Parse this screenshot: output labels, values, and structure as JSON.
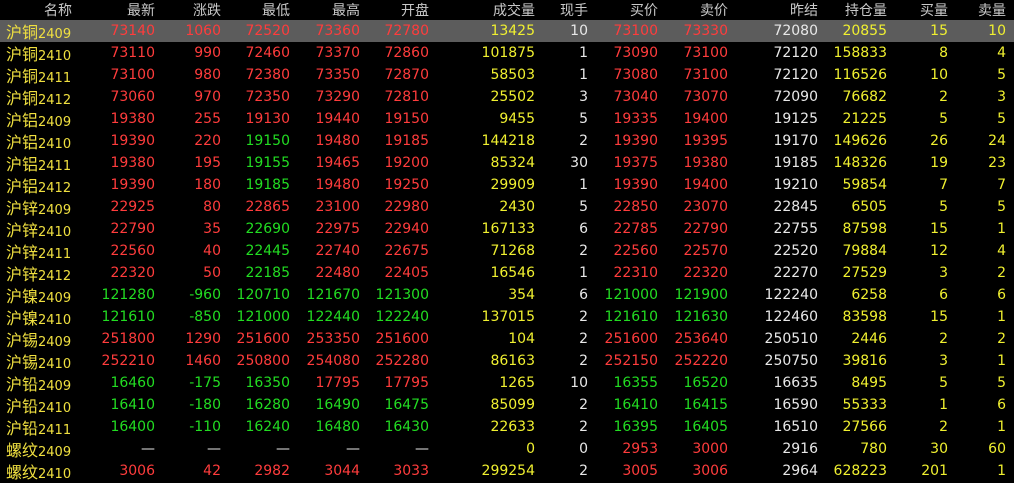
{
  "headers": [
    "名称",
    "最新",
    "涨跌",
    "最低",
    "最高",
    "开盘",
    "成交量",
    "现手",
    "买价",
    "卖价",
    "昨结",
    "持仓量",
    "买量",
    "卖量"
  ],
  "colors": {
    "up": "#ff3c3c",
    "down": "#22dd22",
    "flat": "#e8e8e8",
    "name": "#f0e040",
    "volume": "#f0f030",
    "selected_row": "#5c5c5c"
  },
  "rows": [
    {
      "zh": "沪铜",
      "code": "2409",
      "last": "73140",
      "change": "1060",
      "low": "72520",
      "high": "73360",
      "open": "72780",
      "volume": "13425",
      "cur_hand": "10",
      "bid": "73100",
      "ask": "73330",
      "prev_settle": "72080",
      "open_interest": "20855",
      "bid_vol": "15",
      "ask_vol": "10",
      "c": [
        "r",
        "r",
        "r",
        "r",
        "r",
        "r",
        "r"
      ]
    },
    {
      "zh": "沪铜",
      "code": "2410",
      "last": "73110",
      "change": "990",
      "low": "72460",
      "high": "73370",
      "open": "72860",
      "volume": "101875",
      "cur_hand": "1",
      "bid": "73090",
      "ask": "73100",
      "prev_settle": "72120",
      "open_interest": "158833",
      "bid_vol": "8",
      "ask_vol": "4",
      "c": [
        "r",
        "r",
        "r",
        "r",
        "r",
        "r",
        "r"
      ]
    },
    {
      "zh": "沪铜",
      "code": "2411",
      "last": "73100",
      "change": "980",
      "low": "72380",
      "high": "73350",
      "open": "72870",
      "volume": "58503",
      "cur_hand": "1",
      "bid": "73080",
      "ask": "73100",
      "prev_settle": "72120",
      "open_interest": "116526",
      "bid_vol": "10",
      "ask_vol": "5",
      "c": [
        "r",
        "r",
        "r",
        "r",
        "r",
        "r",
        "r"
      ]
    },
    {
      "zh": "沪铜",
      "code": "2412",
      "last": "73060",
      "change": "970",
      "low": "72350",
      "high": "73290",
      "open": "72810",
      "volume": "25502",
      "cur_hand": "3",
      "bid": "73040",
      "ask": "73070",
      "prev_settle": "72090",
      "open_interest": "76682",
      "bid_vol": "2",
      "ask_vol": "3",
      "c": [
        "r",
        "r",
        "r",
        "r",
        "r",
        "r",
        "r"
      ]
    },
    {
      "zh": "沪铝",
      "code": "2409",
      "last": "19380",
      "change": "255",
      "low": "19130",
      "high": "19440",
      "open": "19150",
      "volume": "9455",
      "cur_hand": "5",
      "bid": "19335",
      "ask": "19400",
      "prev_settle": "19125",
      "open_interest": "21225",
      "bid_vol": "5",
      "ask_vol": "5",
      "c": [
        "r",
        "r",
        "r",
        "r",
        "r",
        "r",
        "r"
      ]
    },
    {
      "zh": "沪铝",
      "code": "2410",
      "last": "19390",
      "change": "220",
      "low": "19150",
      "high": "19480",
      "open": "19185",
      "volume": "144218",
      "cur_hand": "2",
      "bid": "19390",
      "ask": "19395",
      "prev_settle": "19170",
      "open_interest": "149626",
      "bid_vol": "26",
      "ask_vol": "24",
      "c": [
        "r",
        "r",
        "g",
        "r",
        "r",
        "r",
        "r"
      ]
    },
    {
      "zh": "沪铝",
      "code": "2411",
      "last": "19380",
      "change": "195",
      "low": "19155",
      "high": "19465",
      "open": "19200",
      "volume": "85324",
      "cur_hand": "30",
      "bid": "19375",
      "ask": "19380",
      "prev_settle": "19185",
      "open_interest": "148326",
      "bid_vol": "19",
      "ask_vol": "23",
      "c": [
        "r",
        "r",
        "g",
        "r",
        "r",
        "r",
        "r"
      ]
    },
    {
      "zh": "沪铝",
      "code": "2412",
      "last": "19390",
      "change": "180",
      "low": "19185",
      "high": "19480",
      "open": "19250",
      "volume": "29909",
      "cur_hand": "1",
      "bid": "19390",
      "ask": "19400",
      "prev_settle": "19210",
      "open_interest": "59854",
      "bid_vol": "7",
      "ask_vol": "7",
      "c": [
        "r",
        "r",
        "g",
        "r",
        "r",
        "r",
        "r"
      ]
    },
    {
      "zh": "沪锌",
      "code": "2409",
      "last": "22925",
      "change": "80",
      "low": "22865",
      "high": "23100",
      "open": "22980",
      "volume": "2430",
      "cur_hand": "5",
      "bid": "22850",
      "ask": "23070",
      "prev_settle": "22845",
      "open_interest": "6505",
      "bid_vol": "5",
      "ask_vol": "5",
      "c": [
        "r",
        "r",
        "r",
        "r",
        "r",
        "r",
        "r"
      ]
    },
    {
      "zh": "沪锌",
      "code": "2410",
      "last": "22790",
      "change": "35",
      "low": "22690",
      "high": "22975",
      "open": "22940",
      "volume": "167133",
      "cur_hand": "6",
      "bid": "22785",
      "ask": "22790",
      "prev_settle": "22755",
      "open_interest": "87598",
      "bid_vol": "15",
      "ask_vol": "1",
      "c": [
        "r",
        "r",
        "g",
        "r",
        "r",
        "r",
        "r"
      ]
    },
    {
      "zh": "沪锌",
      "code": "2411",
      "last": "22560",
      "change": "40",
      "low": "22445",
      "high": "22740",
      "open": "22675",
      "volume": "71268",
      "cur_hand": "2",
      "bid": "22560",
      "ask": "22570",
      "prev_settle": "22520",
      "open_interest": "79884",
      "bid_vol": "12",
      "ask_vol": "4",
      "c": [
        "r",
        "r",
        "g",
        "r",
        "r",
        "r",
        "r"
      ]
    },
    {
      "zh": "沪锌",
      "code": "2412",
      "last": "22320",
      "change": "50",
      "low": "22185",
      "high": "22480",
      "open": "22405",
      "volume": "16546",
      "cur_hand": "1",
      "bid": "22310",
      "ask": "22320",
      "prev_settle": "22270",
      "open_interest": "27529",
      "bid_vol": "3",
      "ask_vol": "2",
      "c": [
        "r",
        "r",
        "g",
        "r",
        "r",
        "r",
        "r"
      ]
    },
    {
      "zh": "沪镍",
      "code": "2409",
      "last": "121280",
      "change": "-960",
      "low": "120710",
      "high": "121670",
      "open": "121300",
      "volume": "354",
      "cur_hand": "6",
      "bid": "121000",
      "ask": "121900",
      "prev_settle": "122240",
      "open_interest": "6258",
      "bid_vol": "6",
      "ask_vol": "6",
      "c": [
        "g",
        "g",
        "g",
        "g",
        "g",
        "g",
        "g"
      ]
    },
    {
      "zh": "沪镍",
      "code": "2410",
      "last": "121610",
      "change": "-850",
      "low": "121000",
      "high": "122440",
      "open": "122240",
      "volume": "137015",
      "cur_hand": "2",
      "bid": "121610",
      "ask": "121630",
      "prev_settle": "122460",
      "open_interest": "83598",
      "bid_vol": "15",
      "ask_vol": "1",
      "c": [
        "g",
        "g",
        "g",
        "g",
        "g",
        "g",
        "g"
      ]
    },
    {
      "zh": "沪锡",
      "code": "2409",
      "last": "251800",
      "change": "1290",
      "low": "251600",
      "high": "253350",
      "open": "251600",
      "volume": "104",
      "cur_hand": "2",
      "bid": "251600",
      "ask": "253640",
      "prev_settle": "250510",
      "open_interest": "2446",
      "bid_vol": "2",
      "ask_vol": "2",
      "c": [
        "r",
        "r",
        "r",
        "r",
        "r",
        "r",
        "r"
      ]
    },
    {
      "zh": "沪锡",
      "code": "2410",
      "last": "252210",
      "change": "1460",
      "low": "250800",
      "high": "254080",
      "open": "252280",
      "volume": "86163",
      "cur_hand": "2",
      "bid": "252150",
      "ask": "252220",
      "prev_settle": "250750",
      "open_interest": "39816",
      "bid_vol": "3",
      "ask_vol": "1",
      "c": [
        "r",
        "r",
        "r",
        "r",
        "r",
        "r",
        "r"
      ]
    },
    {
      "zh": "沪铅",
      "code": "2409",
      "last": "16460",
      "change": "-175",
      "low": "16350",
      "high": "17795",
      "open": "17795",
      "volume": "1265",
      "cur_hand": "10",
      "bid": "16355",
      "ask": "16520",
      "prev_settle": "16635",
      "open_interest": "8495",
      "bid_vol": "5",
      "ask_vol": "5",
      "c": [
        "g",
        "g",
        "g",
        "r",
        "r",
        "g",
        "g"
      ]
    },
    {
      "zh": "沪铅",
      "code": "2410",
      "last": "16410",
      "change": "-180",
      "low": "16280",
      "high": "16490",
      "open": "16475",
      "volume": "85099",
      "cur_hand": "2",
      "bid": "16410",
      "ask": "16415",
      "prev_settle": "16590",
      "open_interest": "55333",
      "bid_vol": "1",
      "ask_vol": "6",
      "c": [
        "g",
        "g",
        "g",
        "g",
        "g",
        "g",
        "g"
      ]
    },
    {
      "zh": "沪铅",
      "code": "2411",
      "last": "16400",
      "change": "-110",
      "low": "16240",
      "high": "16480",
      "open": "16430",
      "volume": "22633",
      "cur_hand": "2",
      "bid": "16395",
      "ask": "16405",
      "prev_settle": "16510",
      "open_interest": "27566",
      "bid_vol": "2",
      "ask_vol": "1",
      "c": [
        "g",
        "g",
        "g",
        "g",
        "g",
        "g",
        "g"
      ]
    },
    {
      "zh": "螺纹",
      "code": "2409",
      "last": "—",
      "change": "—",
      "low": "—",
      "high": "—",
      "open": "—",
      "volume": "0",
      "cur_hand": "0",
      "bid": "2953",
      "ask": "3000",
      "prev_settle": "2916",
      "open_interest": "780",
      "bid_vol": "30",
      "ask_vol": "60",
      "c": [
        "w",
        "w",
        "w",
        "w",
        "w",
        "r",
        "r"
      ]
    },
    {
      "zh": "螺纹",
      "code": "2410",
      "last": "3006",
      "change": "42",
      "low": "2982",
      "high": "3044",
      "open": "3033",
      "volume": "299254",
      "cur_hand": "2",
      "bid": "3005",
      "ask": "3006",
      "prev_settle": "2964",
      "open_interest": "628223",
      "bid_vol": "201",
      "ask_vol": "1",
      "c": [
        "r",
        "r",
        "r",
        "r",
        "r",
        "r",
        "r"
      ]
    }
  ]
}
